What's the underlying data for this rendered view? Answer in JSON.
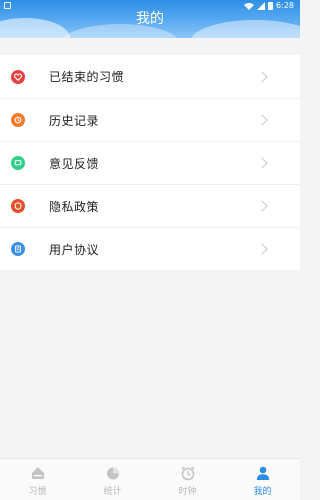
{
  "header": {
    "title": "我的",
    "status_time": "6:28"
  },
  "menu": [
    {
      "label": "已结束的习惯",
      "icon": "heart-icon",
      "color": "#e8413e"
    },
    {
      "label": "历史记录",
      "icon": "clock-icon",
      "color": "#f47a2a"
    },
    {
      "label": "意见反馈",
      "icon": "chat-icon",
      "color": "#2fd08a"
    },
    {
      "label": "隐私政策",
      "icon": "shield-icon",
      "color": "#e6502a"
    },
    {
      "label": "用户协议",
      "icon": "document-icon",
      "color": "#3a8fe6"
    }
  ],
  "tabs": [
    {
      "label": "习惯",
      "icon": "home-icon",
      "active": false
    },
    {
      "label": "统计",
      "icon": "pie-chart-icon",
      "active": false
    },
    {
      "label": "时钟",
      "icon": "alarm-clock-icon",
      "active": false
    },
    {
      "label": "我的",
      "icon": "user-icon",
      "active": true
    }
  ],
  "colors": {
    "accent": "#2a8ce5",
    "tab_inactive": "#b8b8b8"
  }
}
